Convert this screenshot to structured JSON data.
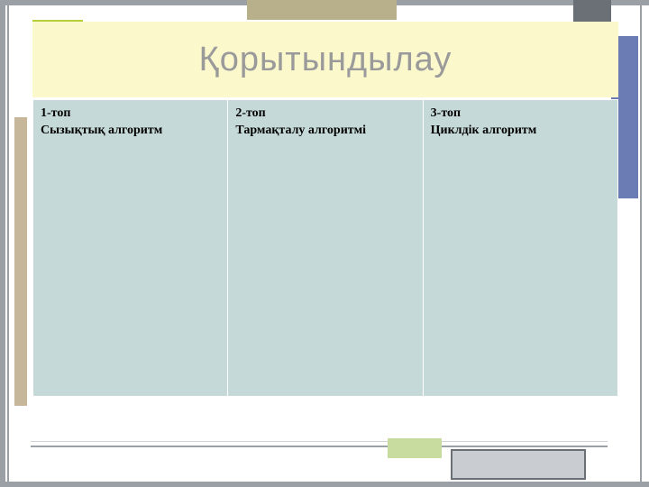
{
  "title": "Қорытындылау",
  "columns": [
    {
      "group": "1-топ",
      "topic": "Сызықтық  алгоритм"
    },
    {
      "group": "2-топ",
      "topic": "Тармақталу алгоритмі"
    },
    {
      "group": "3-топ",
      "topic": "Циклдік алгоритм"
    }
  ],
  "colors": {
    "title_band": "#fbf8cc",
    "title_text": "#9a9a9a",
    "cell_bg": "#c5dad8",
    "accent_green": "#b5cf3a",
    "accent_blue": "#6b7bb3",
    "accent_olive": "#b8b08a",
    "frame_gray": "#9aa0a6"
  }
}
